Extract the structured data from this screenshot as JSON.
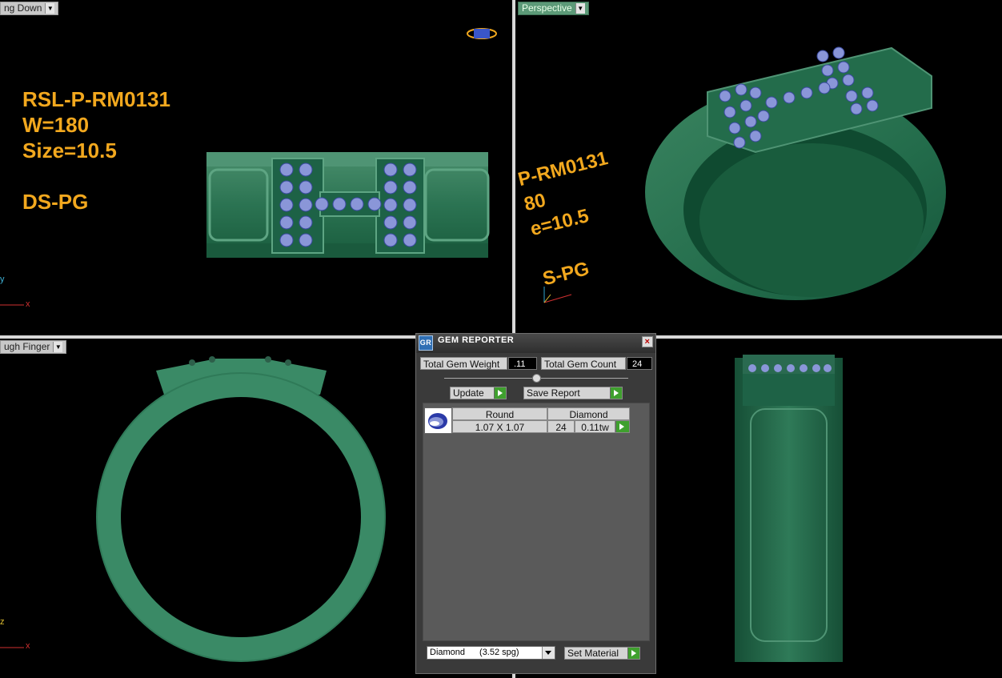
{
  "viewports": {
    "top_left": {
      "label": "ng Down",
      "ring_text": [
        "RSL-P-RM0131",
        "W=180",
        "Size=10.5",
        "",
        "DS-PG"
      ],
      "axis_y": "y",
      "axis_x": "x"
    },
    "top_right": {
      "label": "Perspective",
      "ring_text": [
        "P-RM0131",
        "80",
        "e=10.5",
        "",
        "S-PG"
      ]
    },
    "bottom_left": {
      "label": "ugh Finger",
      "axis_z": "z",
      "axis_x": "x"
    }
  },
  "gem_reporter": {
    "title": "GEM REPORTER",
    "logo": "GR",
    "close": "×",
    "total_weight_label": "Total Gem Weight",
    "total_weight_value": ".11",
    "total_count_label": "Total Gem Count",
    "total_count_value": "24",
    "update_label": "Update",
    "save_report_label": "Save Report",
    "rows": [
      {
        "shape": "Round",
        "size": "1.07 X 1.07",
        "material": "Diamond",
        "count": "24",
        "weight": "0.11tw"
      }
    ],
    "material_select": {
      "name": "Diamond",
      "spg": "(3.52 spg)"
    },
    "set_material_label": "Set Material"
  },
  "colors": {
    "ring_green": "#1f6b4c",
    "stone": "#8a96d8",
    "text_orange": "#f2a81e",
    "background": "#000000"
  },
  "icons": [
    "gem-thumb-icon",
    "view-cube-icon",
    "axis-icon",
    "go-arrow-icon",
    "dropdown-arrow-icon"
  ]
}
